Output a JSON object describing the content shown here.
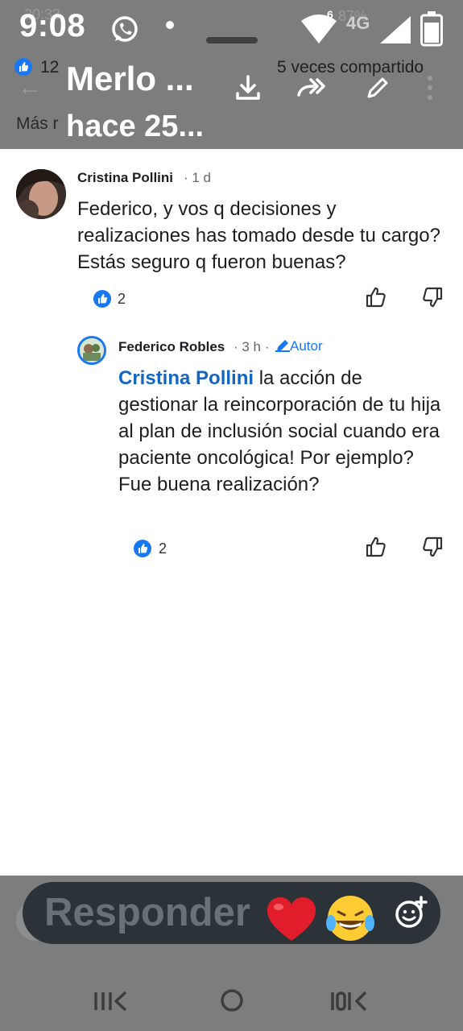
{
  "status_bar": {
    "time": "9:08",
    "ghost_time": "20:33",
    "network": "4G",
    "signal_badge": "6",
    "ghost_battery": "87%"
  },
  "background_header": {
    "like_count": "12",
    "shared": "5 veces compartido",
    "more_replies": "Más r"
  },
  "media_viewer": {
    "title": "Merlo ...",
    "subtitle": "hace 25...",
    "icons": [
      "download-icon",
      "share-icon",
      "edit-icon"
    ]
  },
  "comments": [
    {
      "author": "Cristina Pollini",
      "time": "· 1 d",
      "body": "Federico, y vos q decisiones y realizaciones has tomado desde tu cargo? Estás seguro q fueron buenas?",
      "reaction_count": "2"
    },
    {
      "author": "Federico Robles",
      "time": "· 3 h ·",
      "author_badge": "Autor",
      "mention": "Cristina Pollini",
      "body": " la acción de gestionar la reincorporación de tu hija al plan de inclusión social cuando era paciente oncológica! Por ejemplo? Fue buena realización?",
      "reaction_count": "2"
    }
  ],
  "reply_bar": {
    "label": "Responder"
  },
  "colors": {
    "accent": "#1877f2",
    "mention": "#1565c0",
    "overlay": "#7d7d7d",
    "reply_bar": "#2b3238"
  }
}
